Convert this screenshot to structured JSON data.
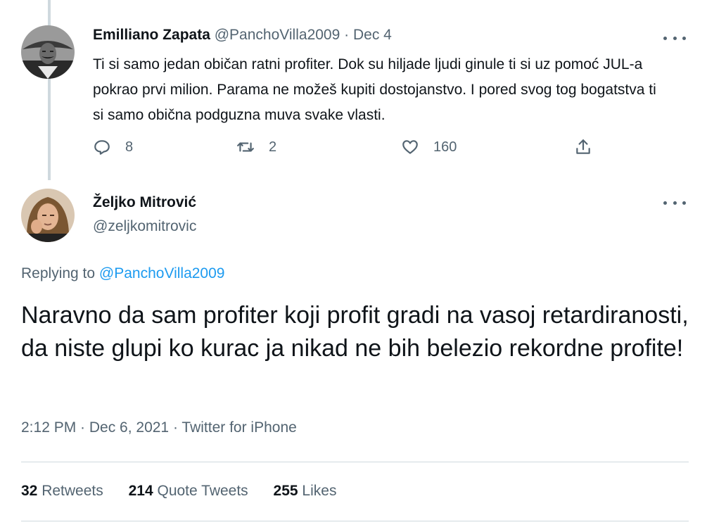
{
  "tweet1": {
    "name": "Emilliano Zapata",
    "handle": "@PanchoVilla2009",
    "separator": "·",
    "date": "Dec 4",
    "text": "Ti si samo jedan običan ratni profiter. Dok su hiljade ljudi ginule ti si uz pomoć JUL-a pokrao prvi milion. Parama ne možeš kupiti dostojanstvo. I pored svog tog bogatstva ti si samo obična podguzna muva svake vlasti.",
    "replies": "8",
    "retweets": "2",
    "likes": "160",
    "icons": [
      "reply-icon",
      "retweet-icon",
      "like-icon",
      "share-icon",
      "more-icon"
    ]
  },
  "tweet2": {
    "name": "Željko Mitrović",
    "handle": "@zeljkomitrovic",
    "replying_prefix": "Replying to",
    "replying_to": "@PanchoVilla2009",
    "text": "Naravno da sam profiter koji profit gradi na vasoj retardiranosti, da niste glupi ko kurac ja nikad ne bih belezio rekordne profite!",
    "meta": "2:12 PM · Dec 6, 2021 · Twitter for iPhone",
    "stats": {
      "retweets_count": "32",
      "retweets_label": "Retweets",
      "quotes_count": "214",
      "quotes_label": "Quote Tweets",
      "likes_count": "255",
      "likes_label": "Likes"
    }
  },
  "colors": {
    "text": "#0f1419",
    "muted": "#536471",
    "link": "#1d9bf0",
    "border": "#cfd9de"
  }
}
